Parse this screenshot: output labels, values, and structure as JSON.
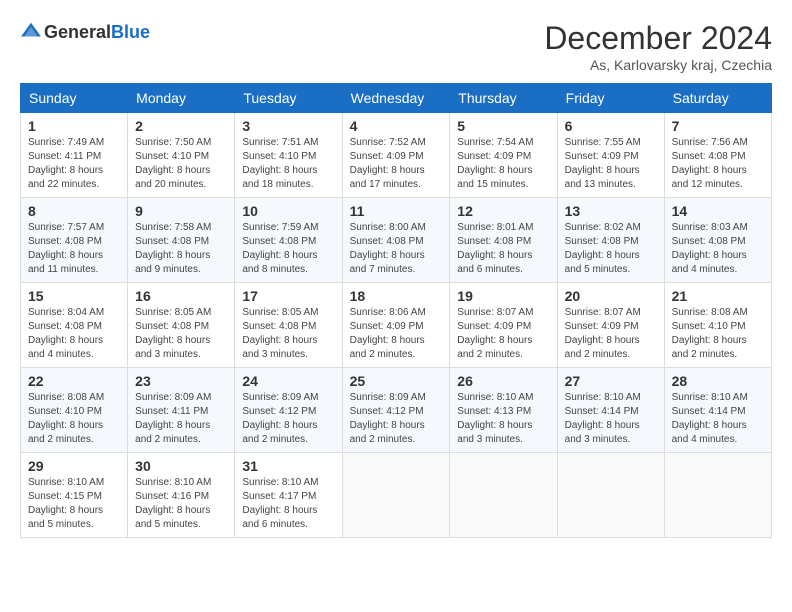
{
  "header": {
    "logo_general": "General",
    "logo_blue": "Blue",
    "title": "December 2024",
    "location": "As, Karlovarsky kraj, Czechia"
  },
  "days_of_week": [
    "Sunday",
    "Monday",
    "Tuesday",
    "Wednesday",
    "Thursday",
    "Friday",
    "Saturday"
  ],
  "weeks": [
    [
      {
        "day": 1,
        "sunrise": "Sunrise: 7:49 AM",
        "sunset": "Sunset: 4:11 PM",
        "daylight": "Daylight: 8 hours and 22 minutes."
      },
      {
        "day": 2,
        "sunrise": "Sunrise: 7:50 AM",
        "sunset": "Sunset: 4:10 PM",
        "daylight": "Daylight: 8 hours and 20 minutes."
      },
      {
        "day": 3,
        "sunrise": "Sunrise: 7:51 AM",
        "sunset": "Sunset: 4:10 PM",
        "daylight": "Daylight: 8 hours and 18 minutes."
      },
      {
        "day": 4,
        "sunrise": "Sunrise: 7:52 AM",
        "sunset": "Sunset: 4:09 PM",
        "daylight": "Daylight: 8 hours and 17 minutes."
      },
      {
        "day": 5,
        "sunrise": "Sunrise: 7:54 AM",
        "sunset": "Sunset: 4:09 PM",
        "daylight": "Daylight: 8 hours and 15 minutes."
      },
      {
        "day": 6,
        "sunrise": "Sunrise: 7:55 AM",
        "sunset": "Sunset: 4:09 PM",
        "daylight": "Daylight: 8 hours and 13 minutes."
      },
      {
        "day": 7,
        "sunrise": "Sunrise: 7:56 AM",
        "sunset": "Sunset: 4:08 PM",
        "daylight": "Daylight: 8 hours and 12 minutes."
      }
    ],
    [
      {
        "day": 8,
        "sunrise": "Sunrise: 7:57 AM",
        "sunset": "Sunset: 4:08 PM",
        "daylight": "Daylight: 8 hours and 11 minutes."
      },
      {
        "day": 9,
        "sunrise": "Sunrise: 7:58 AM",
        "sunset": "Sunset: 4:08 PM",
        "daylight": "Daylight: 8 hours and 9 minutes."
      },
      {
        "day": 10,
        "sunrise": "Sunrise: 7:59 AM",
        "sunset": "Sunset: 4:08 PM",
        "daylight": "Daylight: 8 hours and 8 minutes."
      },
      {
        "day": 11,
        "sunrise": "Sunrise: 8:00 AM",
        "sunset": "Sunset: 4:08 PM",
        "daylight": "Daylight: 8 hours and 7 minutes."
      },
      {
        "day": 12,
        "sunrise": "Sunrise: 8:01 AM",
        "sunset": "Sunset: 4:08 PM",
        "daylight": "Daylight: 8 hours and 6 minutes."
      },
      {
        "day": 13,
        "sunrise": "Sunrise: 8:02 AM",
        "sunset": "Sunset: 4:08 PM",
        "daylight": "Daylight: 8 hours and 5 minutes."
      },
      {
        "day": 14,
        "sunrise": "Sunrise: 8:03 AM",
        "sunset": "Sunset: 4:08 PM",
        "daylight": "Daylight: 8 hours and 4 minutes."
      }
    ],
    [
      {
        "day": 15,
        "sunrise": "Sunrise: 8:04 AM",
        "sunset": "Sunset: 4:08 PM",
        "daylight": "Daylight: 8 hours and 4 minutes."
      },
      {
        "day": 16,
        "sunrise": "Sunrise: 8:05 AM",
        "sunset": "Sunset: 4:08 PM",
        "daylight": "Daylight: 8 hours and 3 minutes."
      },
      {
        "day": 17,
        "sunrise": "Sunrise: 8:05 AM",
        "sunset": "Sunset: 4:08 PM",
        "daylight": "Daylight: 8 hours and 3 minutes."
      },
      {
        "day": 18,
        "sunrise": "Sunrise: 8:06 AM",
        "sunset": "Sunset: 4:09 PM",
        "daylight": "Daylight: 8 hours and 2 minutes."
      },
      {
        "day": 19,
        "sunrise": "Sunrise: 8:07 AM",
        "sunset": "Sunset: 4:09 PM",
        "daylight": "Daylight: 8 hours and 2 minutes."
      },
      {
        "day": 20,
        "sunrise": "Sunrise: 8:07 AM",
        "sunset": "Sunset: 4:09 PM",
        "daylight": "Daylight: 8 hours and 2 minutes."
      },
      {
        "day": 21,
        "sunrise": "Sunrise: 8:08 AM",
        "sunset": "Sunset: 4:10 PM",
        "daylight": "Daylight: 8 hours and 2 minutes."
      }
    ],
    [
      {
        "day": 22,
        "sunrise": "Sunrise: 8:08 AM",
        "sunset": "Sunset: 4:10 PM",
        "daylight": "Daylight: 8 hours and 2 minutes."
      },
      {
        "day": 23,
        "sunrise": "Sunrise: 8:09 AM",
        "sunset": "Sunset: 4:11 PM",
        "daylight": "Daylight: 8 hours and 2 minutes."
      },
      {
        "day": 24,
        "sunrise": "Sunrise: 8:09 AM",
        "sunset": "Sunset: 4:12 PM",
        "daylight": "Daylight: 8 hours and 2 minutes."
      },
      {
        "day": 25,
        "sunrise": "Sunrise: 8:09 AM",
        "sunset": "Sunset: 4:12 PM",
        "daylight": "Daylight: 8 hours and 2 minutes."
      },
      {
        "day": 26,
        "sunrise": "Sunrise: 8:10 AM",
        "sunset": "Sunset: 4:13 PM",
        "daylight": "Daylight: 8 hours and 3 minutes."
      },
      {
        "day": 27,
        "sunrise": "Sunrise: 8:10 AM",
        "sunset": "Sunset: 4:14 PM",
        "daylight": "Daylight: 8 hours and 3 minutes."
      },
      {
        "day": 28,
        "sunrise": "Sunrise: 8:10 AM",
        "sunset": "Sunset: 4:14 PM",
        "daylight": "Daylight: 8 hours and 4 minutes."
      }
    ],
    [
      {
        "day": 29,
        "sunrise": "Sunrise: 8:10 AM",
        "sunset": "Sunset: 4:15 PM",
        "daylight": "Daylight: 8 hours and 5 minutes."
      },
      {
        "day": 30,
        "sunrise": "Sunrise: 8:10 AM",
        "sunset": "Sunset: 4:16 PM",
        "daylight": "Daylight: 8 hours and 5 minutes."
      },
      {
        "day": 31,
        "sunrise": "Sunrise: 8:10 AM",
        "sunset": "Sunset: 4:17 PM",
        "daylight": "Daylight: 8 hours and 6 minutes."
      },
      null,
      null,
      null,
      null
    ]
  ]
}
